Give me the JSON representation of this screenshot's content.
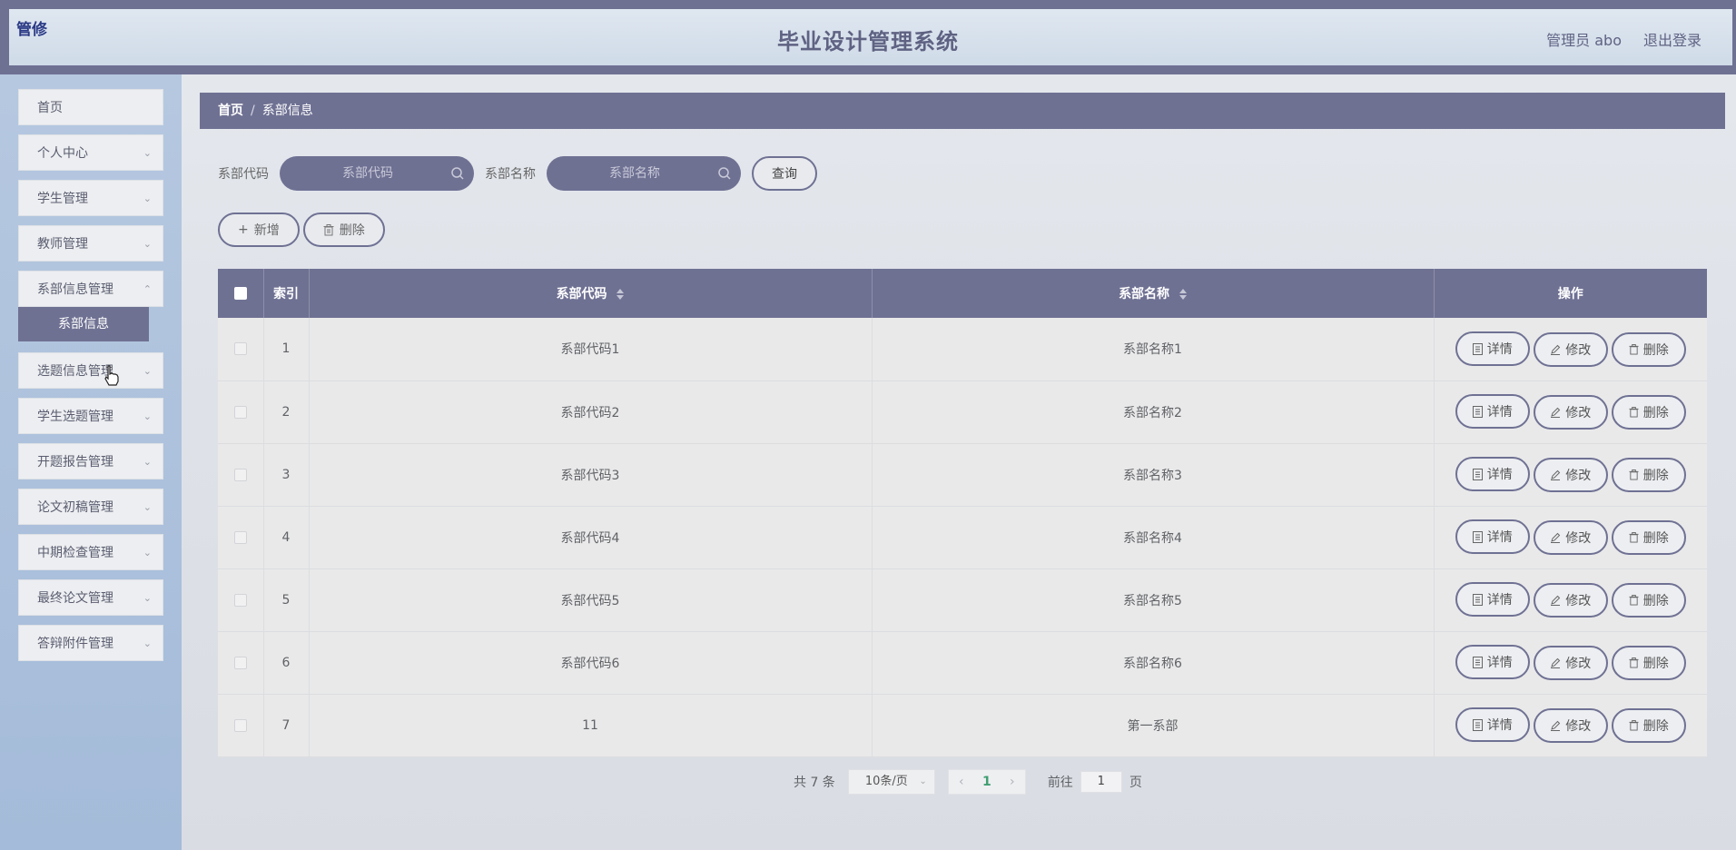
{
  "header": {
    "badge_text": "管修",
    "title": "毕业设计管理系统",
    "user_label": "管理员 abo",
    "logout_label": "退出登录"
  },
  "sidebar": {
    "items": [
      {
        "label": "首页",
        "has_arrow": false
      },
      {
        "label": "个人中心",
        "has_arrow": true
      },
      {
        "label": "学生管理",
        "has_arrow": true
      },
      {
        "label": "教师管理",
        "has_arrow": true
      },
      {
        "label": "系部信息管理",
        "has_arrow": true
      },
      {
        "label": "选题信息管理",
        "has_arrow": true
      },
      {
        "label": "学生选题管理",
        "has_arrow": true
      },
      {
        "label": "开题报告管理",
        "has_arrow": true
      },
      {
        "label": "论文初稿管理",
        "has_arrow": true
      },
      {
        "label": "中期检查管理",
        "has_arrow": true
      },
      {
        "label": "最终论文管理",
        "has_arrow": true
      },
      {
        "label": "答辩附件管理",
        "has_arrow": true
      }
    ],
    "active_submenu": "系部信息"
  },
  "breadcrumb": {
    "home": "首页",
    "separator": "/",
    "current": "系部信息"
  },
  "search": {
    "code_label": "系部代码",
    "code_placeholder": "系部代码",
    "name_label": "系部名称",
    "name_placeholder": "系部名称",
    "query_button": "查询"
  },
  "actions": {
    "add_label": "新增",
    "delete_label": "删除"
  },
  "table": {
    "columns": [
      "索引",
      "系部代码",
      "系部名称",
      "操作"
    ],
    "rows": [
      {
        "index": "1",
        "code": "系部代码1",
        "name": "系部名称1"
      },
      {
        "index": "2",
        "code": "系部代码2",
        "name": "系部名称2"
      },
      {
        "index": "3",
        "code": "系部代码3",
        "name": "系部名称3"
      },
      {
        "index": "4",
        "code": "系部代码4",
        "name": "系部名称4"
      },
      {
        "index": "5",
        "code": "系部代码5",
        "name": "系部名称5"
      },
      {
        "index": "6",
        "code": "系部代码6",
        "name": "系部名称6"
      },
      {
        "index": "7",
        "code": "11",
        "name": "第一系部"
      }
    ],
    "row_actions": {
      "detail": "详情",
      "edit": "修改",
      "delete": "删除"
    }
  },
  "pagination": {
    "total_text": "共 7 条",
    "page_size": "10条/页",
    "current_page": "1",
    "goto_label": "前往",
    "goto_value": "1",
    "page_suffix": "页"
  },
  "colors": {
    "primary": "#6f7193",
    "sidebar_bg": "#a4bbd9",
    "header_bg": "#cfdbe8"
  }
}
